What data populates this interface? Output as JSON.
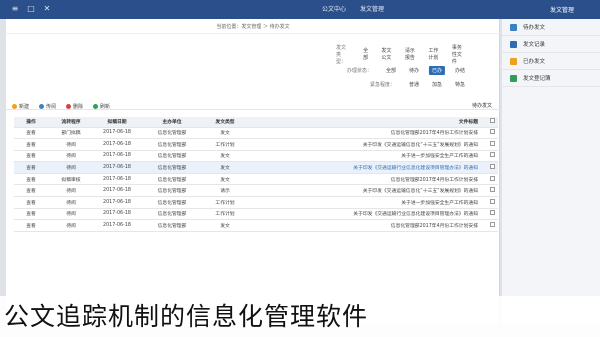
{
  "titlebar": {
    "controls": [
      "≡",
      "□",
      "✕"
    ],
    "tabs": [
      "公文中心",
      "发文管理"
    ],
    "brand": "发文管理"
  },
  "breadcrumb": "当前位置：发文管理 ＞ 待办发文",
  "filters": [
    {
      "label": "发文类型：",
      "items": [
        "全部",
        "发文公文",
        "请示报告",
        "工作计划",
        "事务性文件"
      ],
      "active": -1
    },
    {
      "label": "办理状态：",
      "items": [
        "全部",
        "待办",
        "已办",
        "办结"
      ],
      "active": 2
    },
    {
      "label": "紧急程度：",
      "items": [
        "普通",
        "加急",
        "特急"
      ],
      "active": -1
    }
  ],
  "panel_title": "待办发文",
  "toolbar": [
    {
      "label": "新建",
      "color": "#f0a020"
    },
    {
      "label": "传阅",
      "color": "#3b82c4"
    },
    {
      "label": "删除",
      "color": "#d94040"
    },
    {
      "label": "刷新",
      "color": "#2f9e5a"
    }
  ],
  "sidebar": [
    {
      "label": "待办发文",
      "color": "#3b82c4"
    },
    {
      "label": "发文记录",
      "color": "#2e6db4"
    },
    {
      "label": "已办发文",
      "color": "#f0a020"
    },
    {
      "label": "发文登记簿",
      "color": "#2f9e5a"
    }
  ],
  "table": {
    "headers": [
      "操作",
      "流转程序",
      "拟稿日期",
      "主办单位",
      "发文类型",
      "文件标题"
    ],
    "rows": [
      {
        "action": "查看",
        "process": "部门拟稿",
        "date": "2017-06-18",
        "unit": "信息化管理部",
        "type": "发文",
        "title": "信息化管理部2017年4月份工作计划安排",
        "hl": false,
        "blue": false
      },
      {
        "action": "查看",
        "process": "待阅",
        "date": "2017-06-18",
        "unit": "信息化管理部",
        "type": "工作计划",
        "title": "关于印发《交通运输信息化“十三五”发展规划》的通知",
        "hl": false,
        "blue": false
      },
      {
        "action": "查看",
        "process": "待阅",
        "date": "2017-06-18",
        "unit": "信息化管理部",
        "type": "发文",
        "title": "关于进一步加强安全生产工作的通知",
        "hl": false,
        "blue": false
      },
      {
        "action": "查看",
        "process": "待阅",
        "date": "2017-06-18",
        "unit": "信息化管理部",
        "type": "发文",
        "title": "关于印发《交通运输行业信息化建设项目管理办法》的通知",
        "hl": true,
        "blue": true
      },
      {
        "action": "查看",
        "process": "拟稿审核",
        "date": "2017-06-18",
        "unit": "信息化管理部",
        "type": "发文",
        "title": "信息化管理部2017年4月份工作计划安排",
        "hl": false,
        "blue": false
      },
      {
        "action": "查看",
        "process": "待阅",
        "date": "2017-06-18",
        "unit": "信息化管理部",
        "type": "请示",
        "title": "关于印发《交通运输信息化“十三五”发展规划》的通知",
        "hl": false,
        "blue": false
      },
      {
        "action": "查看",
        "process": "待阅",
        "date": "2017-06-18",
        "unit": "信息化管理部",
        "type": "工作计划",
        "title": "关于进一步加强安全生产工作的通知",
        "hl": false,
        "blue": false
      },
      {
        "action": "查看",
        "process": "待阅",
        "date": "2017-06-18",
        "unit": "信息化管理部",
        "type": "工作计划",
        "title": "关于印发《交通运输行业信息化建设项目管理办法》的通知",
        "hl": false,
        "blue": false
      },
      {
        "action": "查看",
        "process": "待阅",
        "date": "2017-06-18",
        "unit": "信息化管理部",
        "type": "发文",
        "title": "信息化管理部2017年4月份工作计划安排",
        "hl": false,
        "blue": false
      }
    ]
  },
  "caption": "公文追踪机制的信息化管理软件"
}
